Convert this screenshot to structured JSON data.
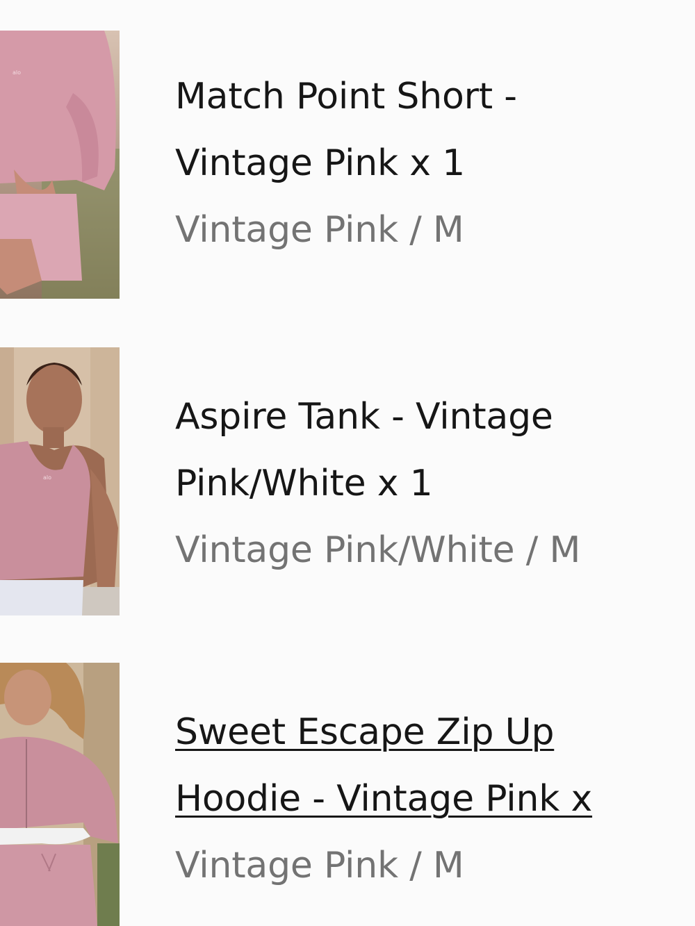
{
  "order_items": [
    {
      "title_line1": "Match Point Short -",
      "title_line2": "Vintage Pink x 1",
      "variant": "Vintage Pink / M",
      "thumbnail": "model-in-pink-sweatshirt-and-shorts"
    },
    {
      "title_line1": "Aspire Tank - Vintage",
      "title_line2": "Pink/White x 1",
      "variant": "Vintage Pink/White / M",
      "thumbnail": "model-in-pink-ribbed-tank"
    },
    {
      "title_line1": "Sweet Escape Zip Up",
      "title_line2": "Hoodie - Vintage Pink x",
      "variant": "Vintage Pink / M",
      "thumbnail": "model-in-pink-zip-hoodie"
    }
  ],
  "colors": {
    "text": "#161616",
    "muted": "#737373",
    "product_pink": "#c98f9c",
    "background": "#fbfbfb"
  }
}
